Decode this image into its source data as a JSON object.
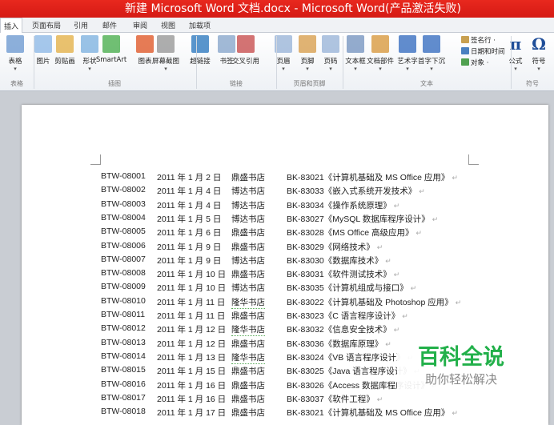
{
  "title": "新建 Microsoft Word 文档.docx - Microsoft Word(产品激活失败)",
  "tabs": [
    "插入",
    "页面布局",
    "引用",
    "邮件",
    "审阅",
    "视图",
    "加载项"
  ],
  "ribbon": {
    "buttons": [
      {
        "label": "表格",
        "color": "#6f9bd1"
      },
      {
        "label": "图片",
        "color": "#8fb9e6"
      },
      {
        "label": "剪贴画",
        "color": "#e3b24a"
      },
      {
        "label": "形状",
        "color": "#7fb3e0"
      },
      {
        "label": "SmartArt",
        "color": "#4caf50"
      },
      {
        "label": "图表",
        "color": "#e05a2a"
      },
      {
        "label": "屏幕截图",
        "color": "#999999"
      },
      {
        "label": "超链接",
        "color": "#2f7bbf"
      },
      {
        "label": "书签",
        "color": "#8aa8cc"
      },
      {
        "label": "交叉引用",
        "color": "#c85050"
      },
      {
        "label": "页眉",
        "color": "#9bb5d8"
      },
      {
        "label": "页脚",
        "color": "#d8a050"
      },
      {
        "label": "页码",
        "color": "#9bb5d8"
      },
      {
        "label": "文本框",
        "color": "#7896c0"
      },
      {
        "label": "文档部件",
        "color": "#d89a40"
      },
      {
        "label": "艺术字",
        "color": "#3a6fc0"
      },
      {
        "label": "首字下沉",
        "color": "#3a6fc0"
      },
      {
        "label": "公式",
        "color": "#1f4e99"
      },
      {
        "label": "符号",
        "color": "#1f4e99"
      }
    ],
    "small": [
      {
        "label": "签名行 ·",
        "color": "#c8a050"
      },
      {
        "label": "日期和时间",
        "color": "#4a80c0"
      },
      {
        "label": "对象 ·",
        "color": "#50a050"
      }
    ],
    "groups": [
      "表格",
      "插图",
      "链接",
      "页眉和页脚",
      "文本",
      "符号"
    ],
    "pi": "π",
    "omega": "Ω"
  },
  "rows": [
    [
      "BTW-08001",
      "2011 年 1 月 2 日",
      "鼎盛书店",
      "BK-83021《计算机基础及 MS Office 应用》"
    ],
    [
      "BTW-08002",
      "2011 年 1 月 4 日",
      "博达书店",
      "BK-83033《嵌入式系统开发技术》"
    ],
    [
      "BTW-08003",
      "2011 年 1 月 4 日",
      "博达书店",
      "BK-83034《操作系统原理》"
    ],
    [
      "BTW-08004",
      "2011 年 1 月 5 日",
      "博达书店",
      "BK-83027《MySQL 数据库程序设计》"
    ],
    [
      "BTW-08005",
      "2011 年 1 月 6 日",
      "鼎盛书店",
      "BK-83028《MS Office 高级应用》"
    ],
    [
      "BTW-08006",
      "2011 年 1 月 9 日",
      "鼎盛书店",
      "BK-83029《网络技术》"
    ],
    [
      "BTW-08007",
      "2011 年 1 月 9 日",
      "博达书店",
      "BK-83030《数据库技术》"
    ],
    [
      "BTW-08008",
      "2011 年 1 月 10 日",
      "鼎盛书店",
      "BK-83031《软件测试技术》"
    ],
    [
      "BTW-08009",
      "2011 年 1 月 10 日",
      "博达书店",
      "BK-83035《计算机组成与接口》"
    ],
    [
      "BTW-08010",
      "2011 年 1 月 11 日",
      "隆华书店",
      "BK-83022《计算机基础及 Photoshop 应用》"
    ],
    [
      "BTW-08011",
      "2011 年 1 月 11 日",
      "鼎盛书店",
      "BK-83023《C 语言程序设计》"
    ],
    [
      "BTW-08012",
      "2011 年 1 月 12 日",
      "隆华书店",
      "BK-83032《信息安全技术》"
    ],
    [
      "BTW-08013",
      "2011 年 1 月 12 日",
      "鼎盛书店",
      "BK-83036《数据库原理》"
    ],
    [
      "BTW-08014",
      "2011 年 1 月 13 日",
      "隆华书店",
      "BK-83024《VB 语言程序设计》"
    ],
    [
      "BTW-08015",
      "2011 年 1 月 15 日",
      "鼎盛书店",
      "BK-83025《Java 语言程序设计》"
    ],
    [
      "BTW-08016",
      "2011 年 1 月 16 日",
      "鼎盛书店",
      "BK-83026《Access 数据库程序设计》"
    ],
    [
      "BTW-08017",
      "2011 年 1 月 16 日",
      "鼎盛书店",
      "BK-83037《软件工程》"
    ],
    [
      "BTW-08018",
      "2011 年 1 月 17 日",
      "鼎盛书店",
      "BK-83021《计算机基础及 MS Office 应用》"
    ]
  ],
  "paragraph_mark": "↵",
  "watermark": {
    "title": "百科全说",
    "subtitle": "助你轻松解决"
  }
}
